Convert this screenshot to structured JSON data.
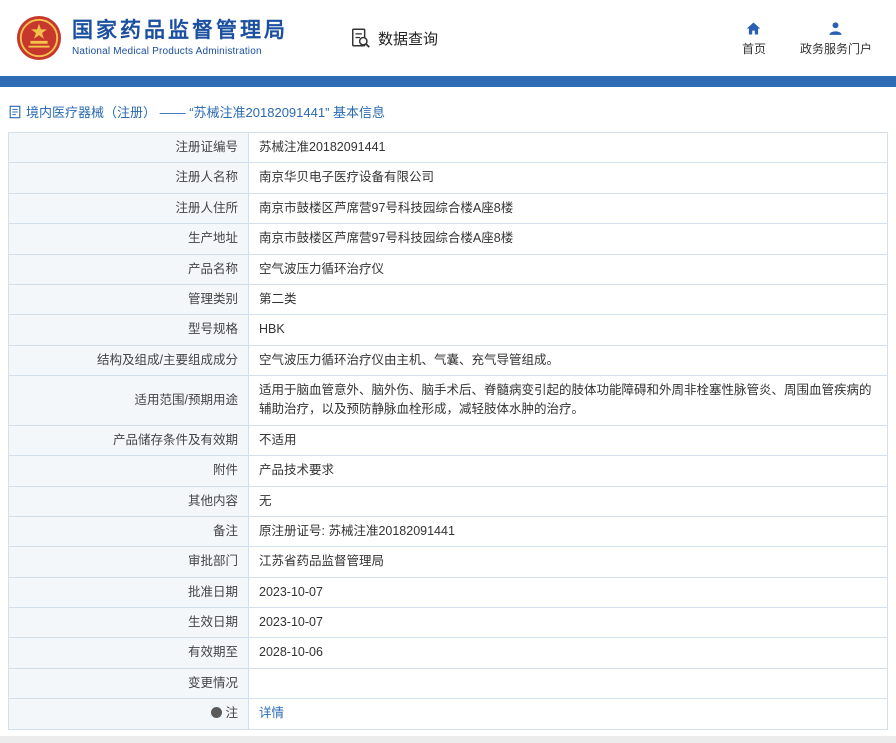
{
  "header": {
    "agency_name": "国家药品监督管理局",
    "agency_name_en": "National Medical Products Administration",
    "section_title": "数据查询",
    "home_label": "首页",
    "portal_label": "政务服务门户"
  },
  "breadcrumb": {
    "text": "境内医疗器械（注册） —— “苏械注准20182091441” 基本信息"
  },
  "colors": {
    "accent_blue": "#2e6cb5",
    "title_blue": "#1b4fa0",
    "emblem_red": "#c8372d",
    "emblem_gold": "#f3c24a"
  },
  "table": {
    "rows": [
      {
        "label": "注册证编号",
        "value": "苏械注准20182091441"
      },
      {
        "label": "注册人名称",
        "value": "南京华贝电子医疗设备有限公司"
      },
      {
        "label": "注册人住所",
        "value": "南京市鼓楼区芦席营97号科技园综合楼A座8楼"
      },
      {
        "label": "生产地址",
        "value": "南京市鼓楼区芦席营97号科技园综合楼A座8楼"
      },
      {
        "label": "产品名称",
        "value": "空气波压力循环治疗仪"
      },
      {
        "label": "管理类别",
        "value": "第二类"
      },
      {
        "label": "型号规格",
        "value": "HBK"
      },
      {
        "label": "结构及组成/主要组成成分",
        "value": "空气波压力循环治疗仪由主机、气囊、充气导管组成。"
      },
      {
        "label": "适用范围/预期用途",
        "value": "适用于脑血管意外、脑外伤、脑手术后、脊髓病变引起的肢体功能障碍和外周非栓塞性脉管炎、周围血管疾病的辅助治疗，以及预防静脉血栓形成，减轻肢体水肿的治疗。"
      },
      {
        "label": "产品储存条件及有效期",
        "value": "不适用"
      },
      {
        "label": "附件",
        "value": "产品技术要求"
      },
      {
        "label": "其他内容",
        "value": "无"
      },
      {
        "label": "备注",
        "value": "原注册证号: 苏械注准20182091441"
      },
      {
        "label": "审批部门",
        "value": "江苏省药品监督管理局"
      },
      {
        "label": "批准日期",
        "value": "2023-10-07"
      },
      {
        "label": "生效日期",
        "value": "2023-10-07"
      },
      {
        "label": "有效期至",
        "value": "2028-10-06"
      },
      {
        "label": "变更情况",
        "value": ""
      },
      {
        "label": "注",
        "value": "详情",
        "icon": "dot",
        "link": true
      }
    ]
  }
}
